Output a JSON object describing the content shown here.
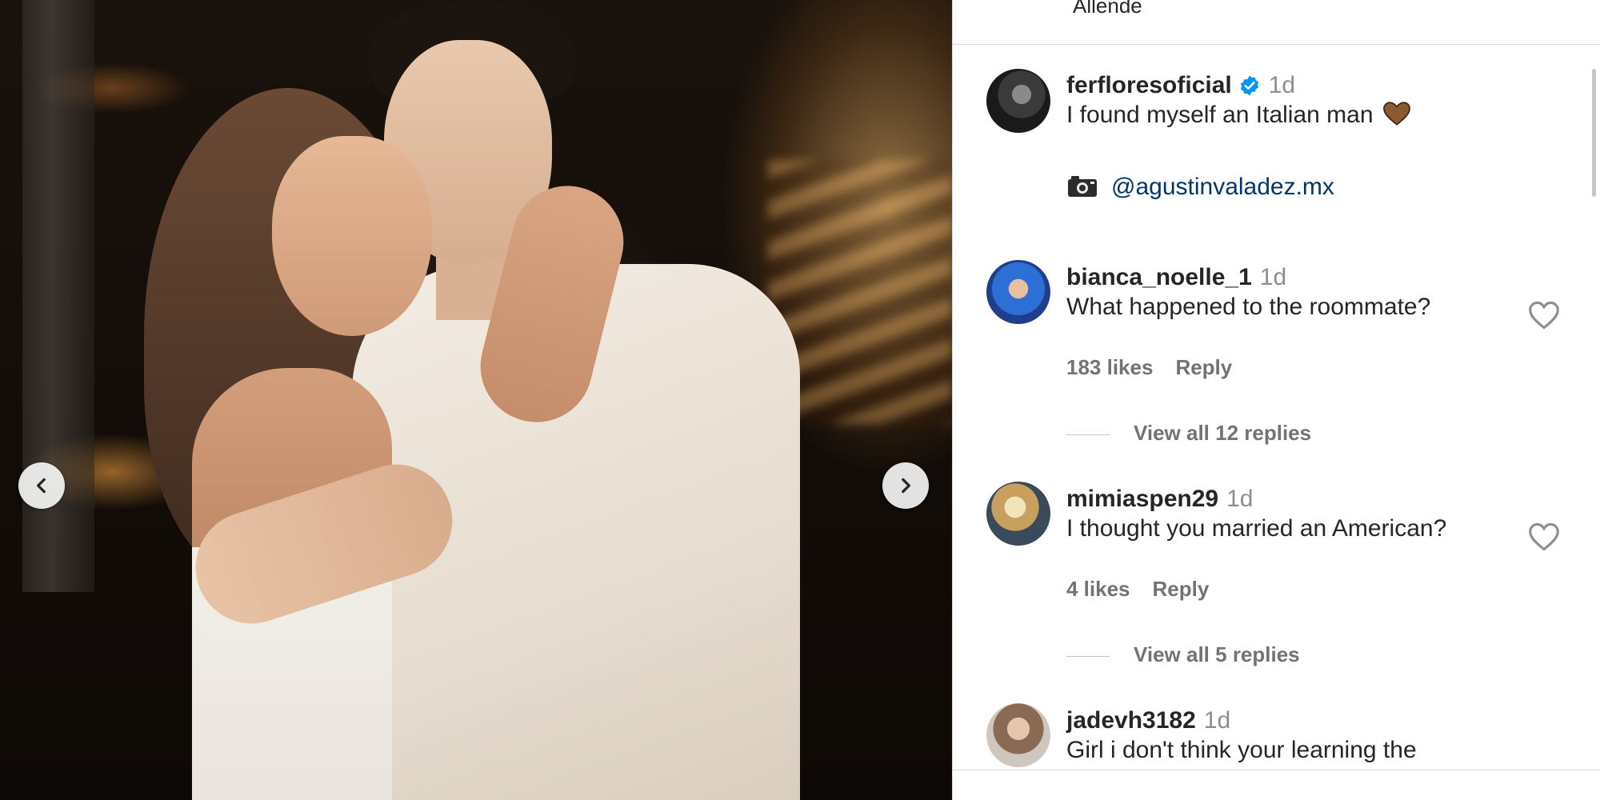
{
  "post": {
    "location": "Allende"
  },
  "carousel": {
    "prev_icon": "chevron-left-icon",
    "next_icon": "chevron-right-icon"
  },
  "caption": {
    "username": "ferfloresoficial",
    "time": "1d",
    "text": "I found myself an Italian man",
    "emoji_icon": "brown-heart-icon",
    "camera_icon": "camera-icon",
    "mention": "@agustinvaladez.mx"
  },
  "comments": [
    {
      "username": "bianca_noelle_1",
      "time": "1d",
      "text": "What happened to the roommate?",
      "likes": "183 likes",
      "reply_label": "Reply",
      "view_replies": "View all 12 replies"
    },
    {
      "username": "mimiaspen29",
      "time": "1d",
      "text": "I thought you married an American?",
      "likes": "4 likes",
      "reply_label": "Reply",
      "view_replies": "View all 5 replies"
    },
    {
      "username": "jadevh3182",
      "time": "1d",
      "text": "Girl i don't think your learning the"
    }
  ],
  "colors": {
    "text": "#262626",
    "muted": "#737373",
    "link": "#00376b",
    "verified": "#0095f6"
  }
}
